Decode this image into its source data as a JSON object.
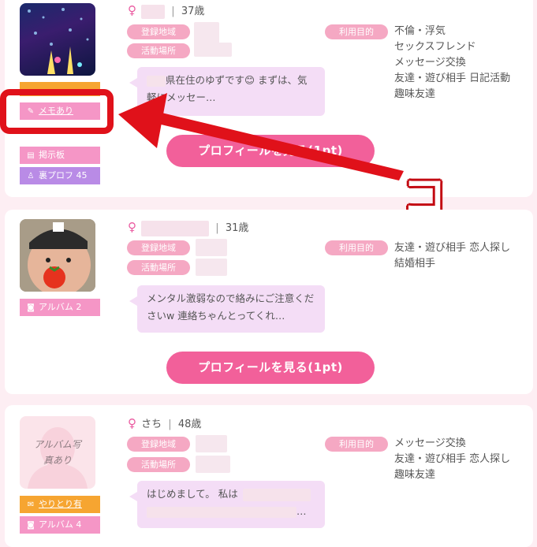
{
  "labels": {
    "registered_area": "登録地域",
    "activity_area": "活動場所",
    "purpose": "利用目的",
    "age_sep": "|",
    "gender_symbol": "♀",
    "profile_button": "プロフィールを見る(1pt)"
  },
  "annotation": {
    "callout_text": "ココ！",
    "color": "#e0111a"
  },
  "colors": {
    "accent_pink": "#f2609a",
    "tag_pink": "#f5a8c3",
    "badge_pink": "#f596c6",
    "badge_orange": "#f6a531",
    "badge_purple": "#b98be6",
    "bubble_lavender": "#f4ddf6"
  },
  "cards": [
    {
      "age": "37歳",
      "purposes": [
        "不倫・浮気",
        "セックスフレンド",
        "メッセージ交換",
        "友達・遊び相手 日記活動",
        "趣味友達"
      ],
      "message": "県在住のゆずです😊 まずは、気軽にメッセー…",
      "badges": [
        {
          "icon": "pencil-icon",
          "glyph": "✎",
          "label": "メモあり"
        },
        {
          "icon": "document-icon",
          "glyph": "▤",
          "label": "掲示板"
        },
        {
          "icon": "person-icon",
          "glyph": "♙",
          "label": "裏プロフ 45"
        }
      ]
    },
    {
      "age": "31歳",
      "purposes": [
        "友達・遊び相手 恋人探し",
        "結婚相手"
      ],
      "message": "メンタル激弱なので絡みにご注意くださいw 連絡ちゃんとってくれ…",
      "badges": [
        {
          "icon": "camera-icon",
          "glyph": "◙",
          "label": "アルバム 2"
        }
      ]
    },
    {
      "name": "さち",
      "age": "48歳",
      "avatar_text": "アルバム写真あり",
      "purposes": [
        "メッセージ交換",
        "友達・遊び相手 恋人探し",
        "趣味友達"
      ],
      "message_prefix": "はじめまして。 私は",
      "message_end": "…",
      "badges": [
        {
          "icon": "mail-icon",
          "glyph": "✉",
          "label": "やりとり有"
        },
        {
          "icon": "camera-icon",
          "glyph": "◙",
          "label": "アルバム 4"
        }
      ]
    }
  ]
}
